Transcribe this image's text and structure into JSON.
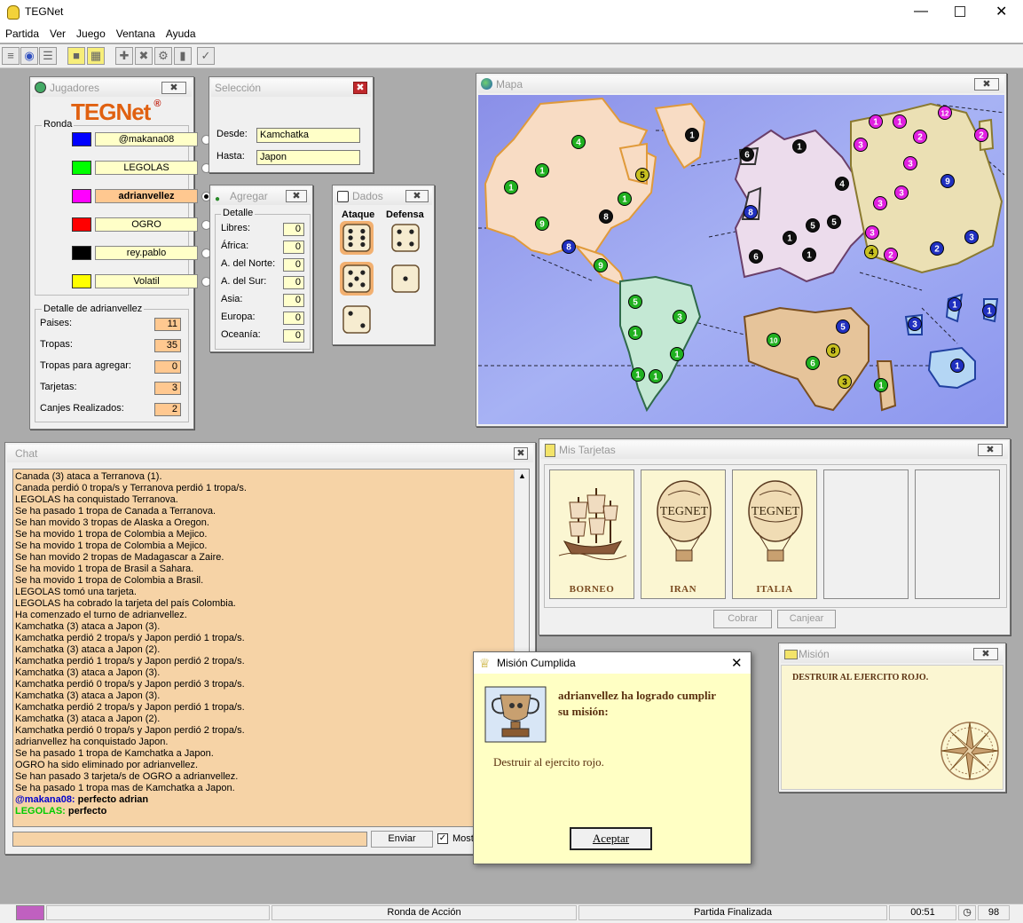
{
  "app": {
    "title": "TEGNet"
  },
  "menu": [
    "Partida",
    "Ver",
    "Juego",
    "Ventana",
    "Ayuda"
  ],
  "jugadores": {
    "title": "Jugadores",
    "logo": "TEGNet",
    "logo_mark": "®",
    "ronda_label": "Ronda",
    "players": [
      {
        "name": "@makana08",
        "color": "#0000ff",
        "bold": false,
        "selected": false
      },
      {
        "name": "LEGOLAS",
        "color": "#00ff00",
        "bold": false,
        "selected": false
      },
      {
        "name": "adrianvellez",
        "color": "#ff00ff",
        "bold": true,
        "selected": true
      },
      {
        "name": "OGRO",
        "color": "#ff0000",
        "bold": false,
        "selected": false
      },
      {
        "name": "rey.pablo",
        "color": "#000000",
        "bold": false,
        "selected": false
      },
      {
        "name": "Volatil",
        "color": "#ffff00",
        "bold": false,
        "selected": false
      }
    ],
    "detalle_label": "Detalle de adrianvellez",
    "stats": [
      {
        "label": "Paises:",
        "value": "11"
      },
      {
        "label": "Tropas:",
        "value": "35"
      },
      {
        "label": "Tropas para agregar:",
        "value": "0"
      },
      {
        "label": "Tarjetas:",
        "value": "3"
      },
      {
        "label": "Canjes Realizados:",
        "value": "2"
      }
    ]
  },
  "seleccion": {
    "title": "Selección",
    "desde_label": "Desde:",
    "desde": "Kamchatka",
    "hasta_label": "Hasta:",
    "hasta": "Japon"
  },
  "agregar": {
    "title": "Agregar",
    "detalle_label": "Detalle",
    "rows": [
      {
        "label": "Libres:",
        "value": "0"
      },
      {
        "label": "África:",
        "value": "0"
      },
      {
        "label": "A. del Norte:",
        "value": "0"
      },
      {
        "label": "A. del Sur:",
        "value": "0"
      },
      {
        "label": "Asia:",
        "value": "0"
      },
      {
        "label": "Europa:",
        "value": "0"
      },
      {
        "label": "Oceanía:",
        "value": "0"
      }
    ]
  },
  "dados": {
    "title": "Dados",
    "ataque_label": "Ataque",
    "defensa_label": "Defensa",
    "ataque": [
      6,
      5,
      2
    ],
    "defensa": [
      4,
      1
    ]
  },
  "mapa": {
    "title": "Mapa",
    "armies": [
      {
        "n": "4",
        "c": "g"
      },
      {
        "n": "1",
        "c": "g"
      },
      {
        "n": "1",
        "c": "g"
      },
      {
        "n": "9",
        "c": "g"
      },
      {
        "n": "8",
        "c": "k"
      },
      {
        "n": "8",
        "c": "b"
      },
      {
        "n": "9",
        "c": "g"
      },
      {
        "n": "5",
        "c": "y"
      },
      {
        "n": "1",
        "c": "g"
      },
      {
        "n": "1",
        "c": "k"
      },
      {
        "n": "6",
        "c": "k"
      },
      {
        "n": "1",
        "c": "k"
      },
      {
        "n": "8",
        "c": "b"
      },
      {
        "n": "4",
        "c": "k"
      },
      {
        "n": "1",
        "c": "k"
      },
      {
        "n": "5",
        "c": "k"
      },
      {
        "n": "5",
        "c": "k"
      },
      {
        "n": "6",
        "c": "k"
      },
      {
        "n": "1",
        "c": "k"
      },
      {
        "n": "1",
        "c": "m"
      },
      {
        "n": "1",
        "c": "m"
      },
      {
        "n": "2",
        "c": "m"
      },
      {
        "n": "12",
        "c": "m"
      },
      {
        "n": "2",
        "c": "m"
      },
      {
        "n": "3",
        "c": "m"
      },
      {
        "n": "3",
        "c": "m"
      },
      {
        "n": "3",
        "c": "m"
      },
      {
        "n": "3",
        "c": "m"
      },
      {
        "n": "9",
        "c": "b"
      },
      {
        "n": "3",
        "c": "m"
      },
      {
        "n": "4",
        "c": "y"
      },
      {
        "n": "2",
        "c": "m"
      },
      {
        "n": "2",
        "c": "b"
      },
      {
        "n": "3",
        "c": "b"
      },
      {
        "n": "5",
        "c": "g"
      },
      {
        "n": "3",
        "c": "g"
      },
      {
        "n": "1",
        "c": "g"
      },
      {
        "n": "1",
        "c": "g"
      },
      {
        "n": "1",
        "c": "g"
      },
      {
        "n": "1",
        "c": "g"
      },
      {
        "n": "10",
        "c": "g"
      },
      {
        "n": "5",
        "c": "b"
      },
      {
        "n": "8",
        "c": "y"
      },
      {
        "n": "6",
        "c": "g"
      },
      {
        "n": "3",
        "c": "y"
      },
      {
        "n": "1",
        "c": "g"
      },
      {
        "n": "1",
        "c": "b"
      },
      {
        "n": "1",
        "c": "b"
      },
      {
        "n": "3",
        "c": "b"
      },
      {
        "n": "1",
        "c": "b"
      }
    ]
  },
  "chat": {
    "title": "Chat",
    "lines": [
      "Canada (3) ataca a Terranova (1).",
      "Canada perdió 0 tropa/s y Terranova perdió 1 tropa/s.",
      "LEGOLAS ha conquistado Terranova.",
      "Se ha pasado 1 tropa de Canada a Terranova.",
      "Se han movido 3 tropas de Alaska a Oregon.",
      "Se ha movido 1 tropa de Colombia a Mejico.",
      "Se ha movido 1 tropa de Colombia a Mejico.",
      "Se han movido 2 tropas de Madagascar a Zaire.",
      "Se ha movido 1 tropa de Brasil a Sahara.",
      "Se ha movido 1 tropa de Colombia a Brasil.",
      "LEGOLAS tomó una tarjeta.",
      "LEGOLAS ha cobrado la tarjeta del país Colombia.",
      "Ha comenzado el turno de adrianvellez.",
      "Kamchatka (3) ataca a Japon (3).",
      "Kamchatka perdió 2 tropa/s y Japon perdió 1 tropa/s.",
      "Kamchatka (3) ataca a Japon (2).",
      "Kamchatka perdió 1 tropa/s y Japon perdió 2 tropa/s.",
      "Kamchatka (3) ataca a Japon (3).",
      "Kamchatka perdió 0 tropa/s y Japon perdió 3 tropa/s.",
      "Kamchatka (3) ataca a Japon (3).",
      "Kamchatka perdió 2 tropa/s y Japon perdió 1 tropa/s.",
      "Kamchatka (3) ataca a Japon (2).",
      "Kamchatka perdió 0 tropa/s y Japon perdió 2 tropa/s.",
      "adrianvellez ha conquistado Japon.",
      "Se ha pasado 1 tropa de Kamchatka a Japon.",
      "OGRO ha sido eliminado por adrianvellez.",
      "Se han pasado 3 tarjeta/s de OGRO a adrianvellez.",
      "Se ha pasado 1 tropa mas de Kamchatka a Japon."
    ],
    "messages": [
      {
        "user": "@makana08:",
        "text": "perfecto adrian",
        "color": "#0000cc"
      },
      {
        "user": "LEGOLAS:",
        "text": "perfecto",
        "color": "#00cc00"
      }
    ],
    "input_value": "",
    "send_label": "Enviar",
    "show_label": "Most"
  },
  "tarjetas": {
    "title": "Mis Tarjetas",
    "cards": [
      {
        "name": "BORNEO",
        "kind": "ship"
      },
      {
        "name": "IRAN",
        "kind": "balloon",
        "logo": "TEGNET"
      },
      {
        "name": "ITALIA",
        "kind": "balloon",
        "logo": "TEGNET"
      },
      {
        "name": "",
        "kind": "empty"
      },
      {
        "name": "",
        "kind": "empty"
      }
    ],
    "cobrar_label": "Cobrar",
    "canjear_label": "Canjear"
  },
  "mision": {
    "title": "Misión",
    "text": "DESTRUIR AL EJERCITO ROJO."
  },
  "dialog": {
    "title": "Misión Cumplida",
    "heading": "adrianvellez ha logrado cumplir su misión:",
    "mission": "Destruir al ejercito rojo.",
    "ok_label": "Aceptar"
  },
  "status": {
    "phase": "Ronda de Acción",
    "state": "Partida Finalizada",
    "time": "00:51",
    "count": "98"
  },
  "colors": {
    "chat_bg": "#f6d3a6",
    "map_ocean": "#8c96ee",
    "field_yellow": "#ffffc8",
    "stat_orange": "#ffc890"
  }
}
